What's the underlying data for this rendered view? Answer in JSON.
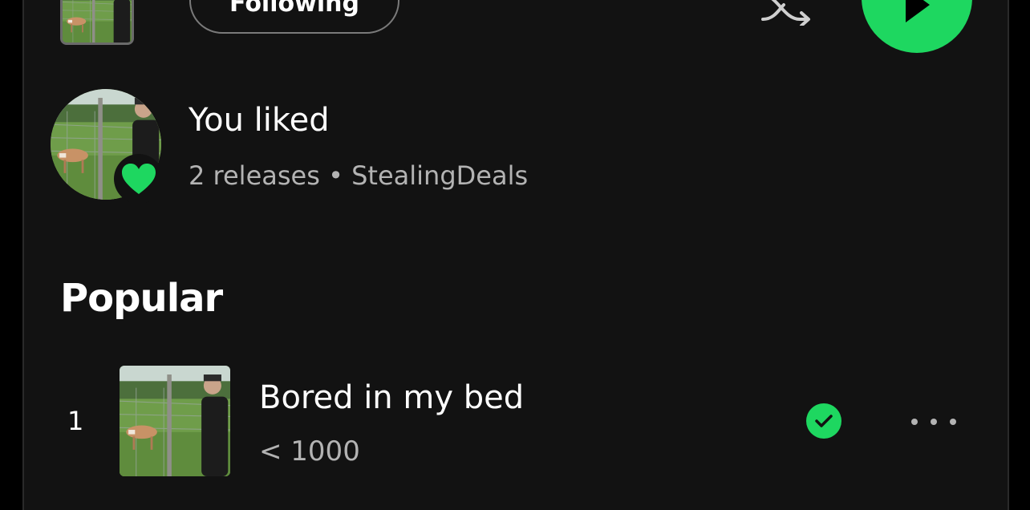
{
  "header": {
    "follow_label": "Following",
    "icons": {
      "more": "more-horizontal-icon",
      "shuffle": "shuffle-icon",
      "play": "play-icon"
    }
  },
  "liked": {
    "title": "You liked",
    "subtitle": "2 releases • StealingDeals",
    "badge_icon": "heart-icon"
  },
  "popular": {
    "heading": "Popular",
    "tracks": [
      {
        "rank": "1",
        "title": "Bored in my bed",
        "plays": "< 1000",
        "saved": true
      }
    ]
  },
  "colors": {
    "accent": "#1ed760",
    "background": "#121212",
    "text_secondary": "#b3b3b3"
  }
}
